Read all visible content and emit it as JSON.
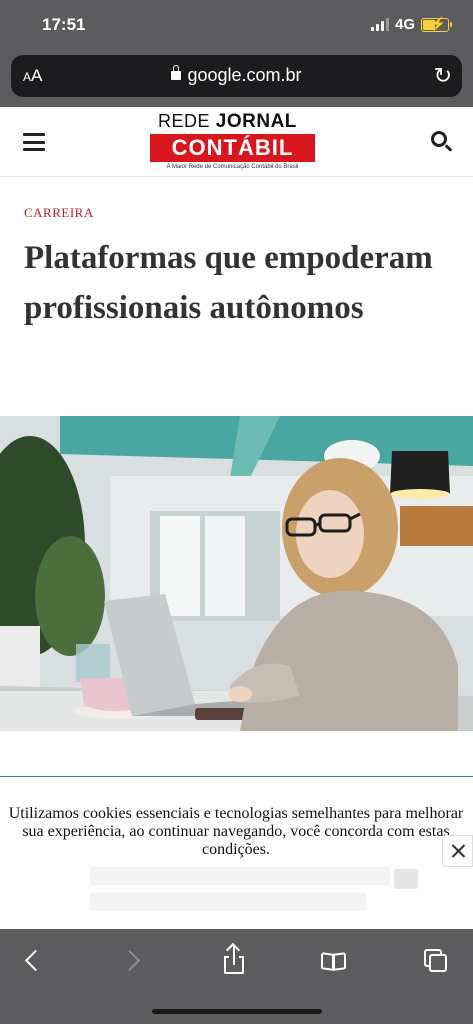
{
  "status_bar": {
    "time": "17:51",
    "network": "4G",
    "battery_level": 0.5,
    "battery_color": "#f3d23b"
  },
  "address_bar": {
    "text_size_label": "AA",
    "url": "google.com.br",
    "reload_icon": "reload-icon"
  },
  "site_header": {
    "menu_icon": "hamburger-menu-icon",
    "logo": {
      "top_plain": "REDE",
      "top_bold": "JORNAL",
      "main": "CONTÁBIL",
      "tagline": "A Maior Rede de Comunicação Contábil do Brasil",
      "brand_color": "#d7161e"
    },
    "search_icon": "search-icon"
  },
  "article": {
    "category": "CARREIRA",
    "category_color": "#c0202a",
    "headline": "Plataformas que empoderam profissionais autônomos"
  },
  "cookie_banner": {
    "text": "Utilizamos cookies essenciais e tecnologias semelhantes para melhorar sua experiência, ao continuar navegando, você concorda com estas condições.",
    "close_icon": "close-icon",
    "accent_color": "#3b7dd8"
  },
  "toolbar": {
    "icons": [
      "back-icon",
      "forward-icon",
      "share-icon",
      "bookmarks-icon",
      "tabs-icon"
    ]
  }
}
